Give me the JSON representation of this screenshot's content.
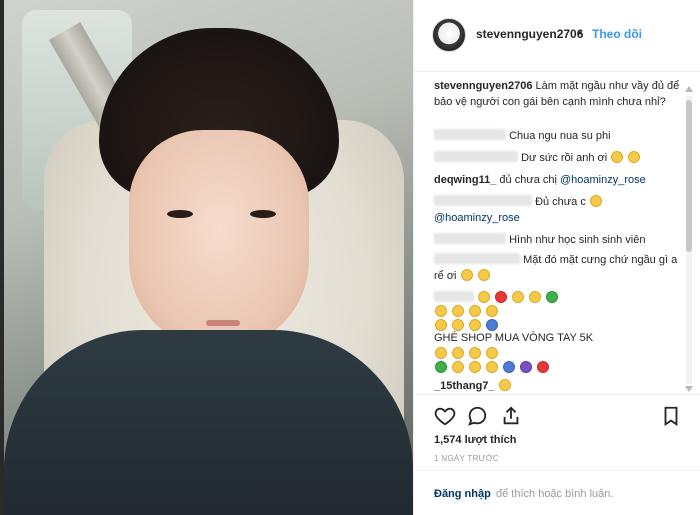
{
  "post": {
    "username": "stevennguyen2706",
    "separator": "•",
    "follow_label": "Theo dõi"
  },
  "caption": {
    "username": "stevennguyen2706",
    "text": "Làm mặt ngầu như vầy đủ để bảo vệ người con gái bên cạnh mình chưa nhỉ?"
  },
  "comments": [
    {
      "text": "Chua ngu nua su phi"
    },
    {
      "text": "Dư sức rồi anh ơi"
    },
    {
      "text": "đủ chưa chị",
      "mention": "@hoaminzy_rose"
    },
    {
      "text": "Đủ chưa c"
    },
    {
      "mention": "@hoaminzy_rose"
    },
    {
      "text": "Hình như học sinh sinh viên"
    },
    {
      "text": "Mặt đó mặt cưng chứ ngầu gì a"
    },
    {
      "text": "rể ơi"
    },
    {
      "text": ""
    },
    {
      "text": ""
    },
    {
      "text": ""
    },
    {
      "text": "GHÉ SHOP MUA VÒNG TAY 5K"
    },
    {
      "text": ""
    },
    {
      "text": ""
    },
    {
      "text": "_15thang7_"
    }
  ],
  "comment_prefix_snippet": "deqwing11_",
  "likes": "1,574 lượt thích",
  "time_ago": "1 ngày trước",
  "login_link": "Đăng nhập",
  "login_text": "để thích hoặc bình luận."
}
